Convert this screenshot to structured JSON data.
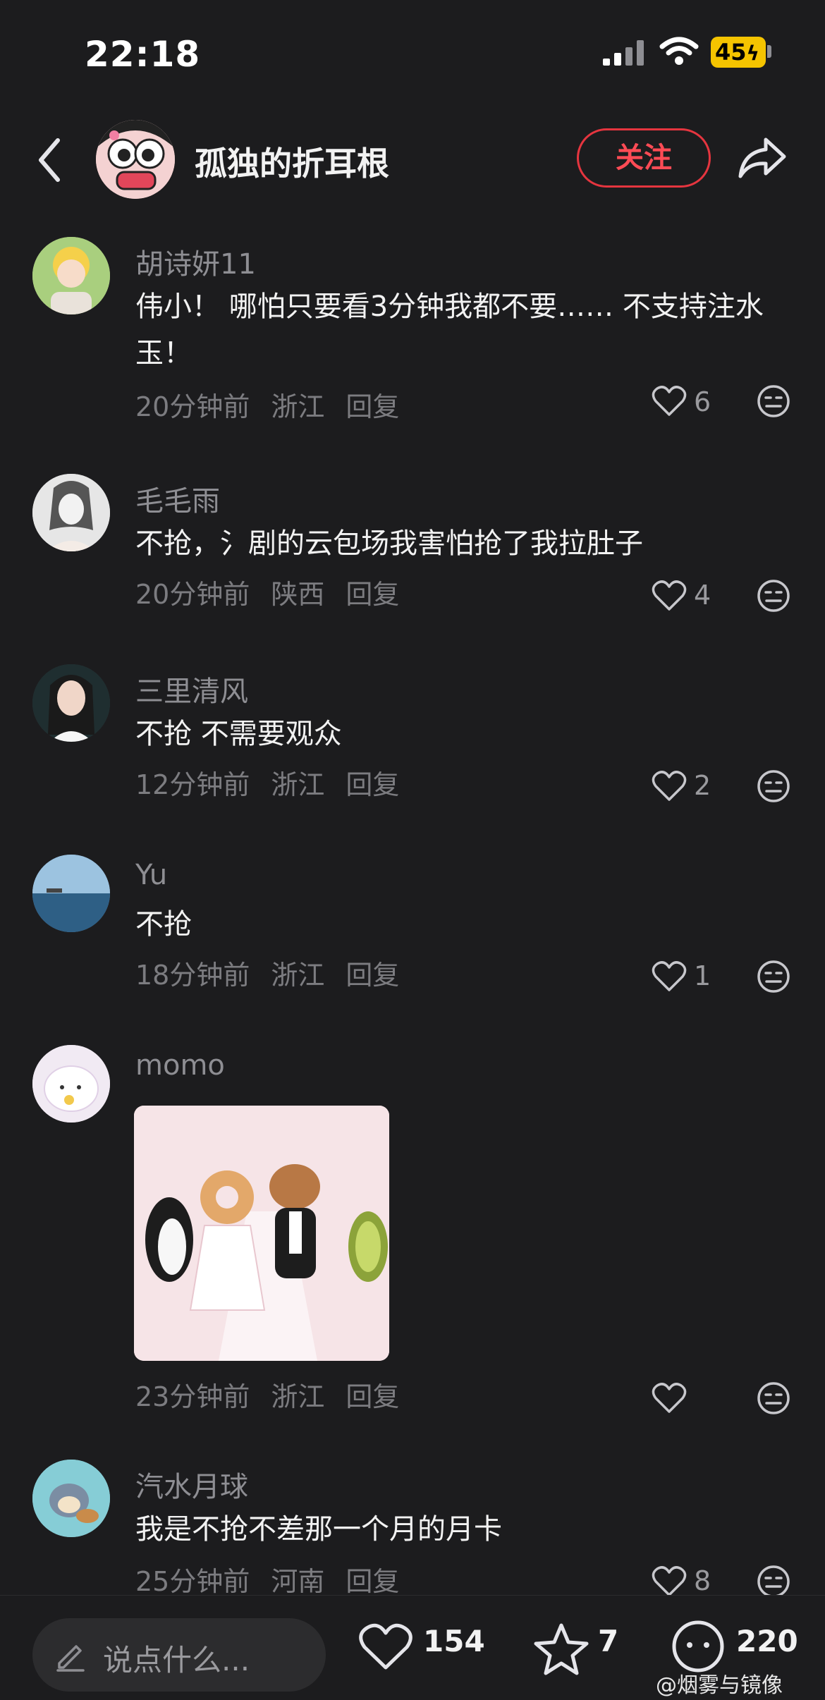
{
  "status_bar": {
    "time": "22:18",
    "battery": "45"
  },
  "header": {
    "username": "孤独的折耳根",
    "follow_label": "关注"
  },
  "comments": [
    {
      "user": "胡诗妍11",
      "text": "伟小！ 哪怕只要看3分钟我都不要…… 不支持注水玉！",
      "time": "20分钟前",
      "location": "浙江",
      "reply": "回复",
      "likes": "6"
    },
    {
      "user": "毛毛雨",
      "text": "不抢，氵剧的云包场我害怕抢了我拉肚子",
      "time": "20分钟前",
      "location": "陕西",
      "reply": "回复",
      "likes": "4"
    },
    {
      "user": "三里清风",
      "text": "不抢 不需要观众",
      "time": "12分钟前",
      "location": "浙江",
      "reply": "回复",
      "likes": "2"
    },
    {
      "user": "Yu",
      "text": "不抢",
      "time": "18分钟前",
      "location": "浙江",
      "reply": "回复",
      "likes": "1"
    },
    {
      "user": "momo",
      "text": "",
      "time": "23分钟前",
      "location": "浙江",
      "reply": "回复",
      "likes": ""
    },
    {
      "user": "汽水月球",
      "text": "我是不抢不差那一个月的月卡",
      "time": "25分钟前",
      "location": "河南",
      "reply": "回复",
      "likes": "8"
    }
  ],
  "bottom_bar": {
    "placeholder": "说点什么...",
    "likes": "154",
    "favorites": "7",
    "comments": "220"
  },
  "watermark": "@烟雾与镜像",
  "colors": {
    "background": "#1c1c1e",
    "accent": "#e5353f",
    "battery": "#f5c400"
  }
}
